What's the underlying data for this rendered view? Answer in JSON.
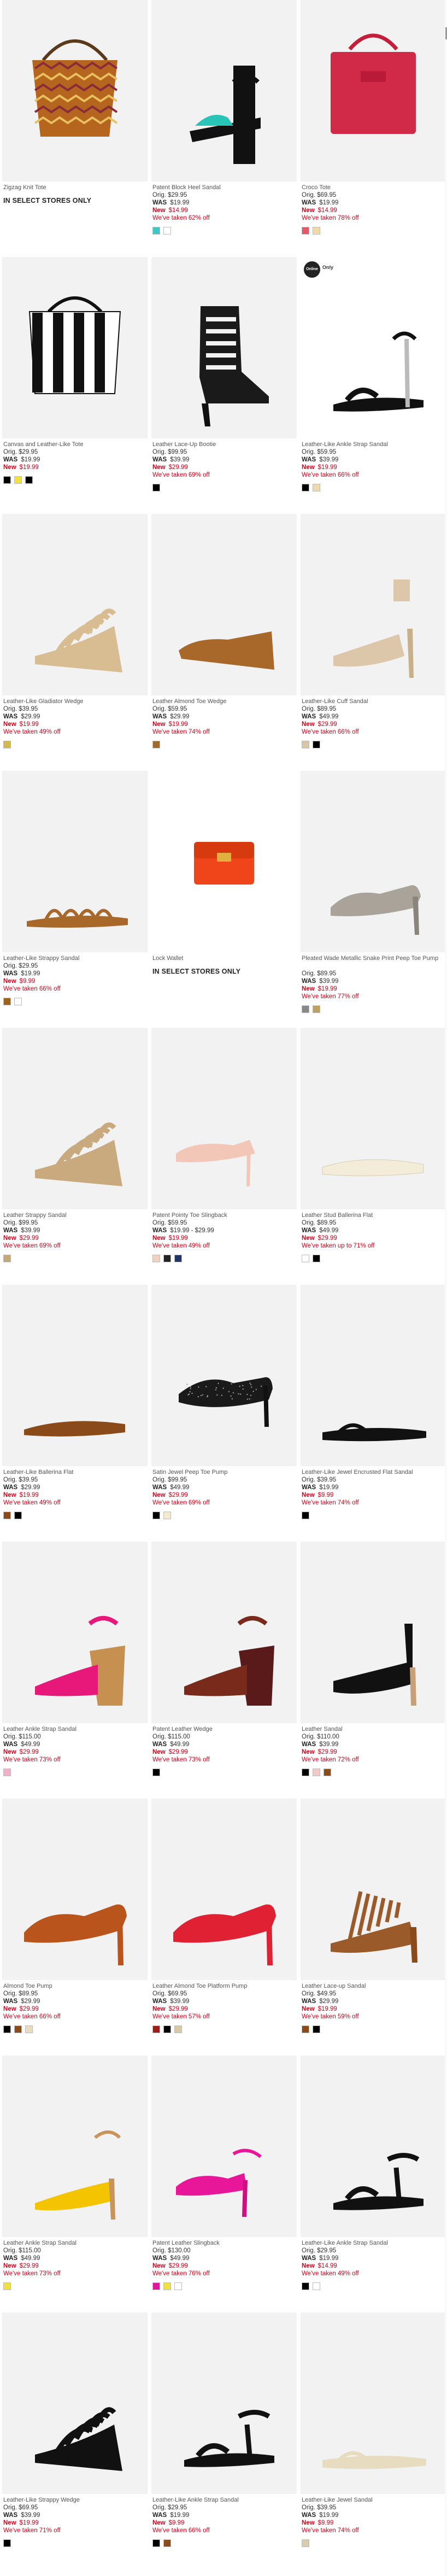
{
  "products": [
    {
      "name": "Zigzag Knit Tote",
      "in_store": "IN SELECT STORES ONLY",
      "shape": "tote-zigzag",
      "swatches": []
    },
    {
      "name": "Patent Block Heel Sandal",
      "orig": "Orig. $29.95",
      "was": "$19.99",
      "new": "$14.99",
      "taken": "We've taken 62% off",
      "shape": "sandal-block",
      "swatches": [
        "#3fc7c7",
        "#ffffff"
      ]
    },
    {
      "name": "Croco Tote",
      "orig": "Orig. $69.95",
      "was": "$19.99",
      "new": "$14.99",
      "taken": "We've taken 78% off",
      "shape": "tote-red",
      "swatches": [
        "#e05a6a",
        "#f2d9a8"
      ]
    },
    {
      "name": "Canvas and Leather-Like Tote",
      "orig": "Orig. $29.95",
      "was": "$19.99",
      "new": "$19.99",
      "shape": "tote-stripe",
      "swatches": [
        "#000000",
        "#f0e040",
        "#000000"
      ]
    },
    {
      "name": "Leather Lace-Up Bootie",
      "orig": "Orig. $99.95",
      "was": "$39.99",
      "new": "$29.99",
      "taken": "We've taken 69% off",
      "shape": "bootie-black",
      "swatches": [
        "#000000"
      ]
    },
    {
      "name": "Leather-Like Ankle Strap Sandal",
      "orig": "Orig. $59.95",
      "was": "$39.99",
      "new": "$19.99",
      "taken": "We've taken 66% off",
      "shape": "sandal-black",
      "badge": "Online",
      "badge_side": "Only",
      "swatches": [
        "#000000",
        "#f0d9b0"
      ]
    },
    {
      "name": "Leather-Like Gladiator Wedge",
      "orig": "Orig. $39.95",
      "was": "$29.99",
      "new": "$19.99",
      "taken": "We've taken 49% off",
      "shape": "wedge-beige",
      "swatches": [
        "#d4b84a"
      ]
    },
    {
      "name": "Leather Almond Toe Wedge",
      "orig": "Orig. $59.95",
      "was": "$29.99",
      "new": "$19.99",
      "taken": "We've taken 74% off",
      "shape": "wedge-tan",
      "swatches": [
        "#a06a2a"
      ]
    },
    {
      "name": "Leather-Like Cuff Sandal",
      "orig": "Orig. $89.95",
      "was": "$49.99",
      "new": "$29.99",
      "taken": "We've taken 66% off",
      "shape": "cuff-nude",
      "swatches": [
        "#d9c6a5",
        "#000000"
      ]
    },
    {
      "name": "Leather-Like Strappy Sandal",
      "orig": "Orig. $29.95",
      "was": "$19.99",
      "new": "$9.99",
      "taken": "We've taken 66% off",
      "shape": "flat-brown",
      "swatches": [
        "#a0621a",
        "#ffffff"
      ]
    },
    {
      "name": "Lock Wallet",
      "in_store": "IN SELECT STORES ONLY",
      "shape": "wallet-red",
      "swatches": []
    },
    {
      "name": "Pleated Wade Metallic Snake Print Peep Toe Pump",
      "orig": "Orig. $89.95",
      "was": "$39.99",
      "new": "$19.99",
      "taken": "We've taken 77% off",
      "shape": "pump-silver",
      "swatches": [
        "#888888",
        "#c0a060"
      ]
    },
    {
      "name": "Leather Strappy Sandal",
      "orig": "Orig. $99.95",
      "was": "$39.99",
      "new": "$29.99",
      "taken": "We've taken 69% off",
      "shape": "strappy-beige",
      "swatches": [
        "#c4a878"
      ]
    },
    {
      "name": "Patent Pointy Toe Slingback",
      "orig": "Orig. $59.95",
      "was": "$19.99 - $29.99",
      "new": "$19.99",
      "taken": "We've taken 49% off",
      "shape": "sling-pink",
      "swatches": [
        "#f3d1c2",
        "#222222",
        "#223366"
      ]
    },
    {
      "name": "Leather Stud Ballerina Flat",
      "orig": "Orig. $89.95",
      "was": "$49.99",
      "new": "$29.99",
      "taken": "We've taken up to 71% off",
      "shape": "flat-white",
      "swatches": [
        "#ffffff",
        "#000000"
      ]
    },
    {
      "name": "Leather-Like Ballerina Flat",
      "orig": "Orig. $39.95",
      "was": "$29.99",
      "new": "$19.99",
      "taken": "We've taken 49% off",
      "shape": "ballet-brown",
      "swatches": [
        "#8a4a1a",
        "#000000"
      ]
    },
    {
      "name": "Satin Jewel Peep Toe Pump",
      "orig": "Orig. $99.95",
      "was": "$49.99",
      "new": "$29.99",
      "taken": "We've taken 69% off",
      "shape": "pump-jewel",
      "swatches": [
        "#000000",
        "#f3ead0"
      ]
    },
    {
      "name": "Leather-Like Jewel Encrusted Flat Sandal",
      "orig": "Orig. $39.95",
      "was": "$19.99",
      "new": "$9.99",
      "taken": "We've taken 74% off",
      "shape": "thong-black",
      "swatches": [
        "#000000"
      ]
    },
    {
      "name": "Leather Ankle Strap Sandal",
      "orig": "Orig. $115.00",
      "was": "$49.99",
      "new": "$29.99",
      "taken": "We've taken 73% off",
      "shape": "wedge-pink",
      "swatches": [
        "#f2b0c8"
      ]
    },
    {
      "name": "Patent Leather Wedge",
      "orig": "Orig. $115.00",
      "was": "$49.99",
      "new": "$29.99",
      "taken": "We've taken 73% off",
      "shape": "wedge-black",
      "swatches": [
        "#000000"
      ]
    },
    {
      "name": "Leather Sandal",
      "orig": "Orig. $110.00",
      "was": "$39.99",
      "new": "$29.99",
      "taken": "We've taken 72% off",
      "shape": "buckle-black",
      "swatches": [
        "#000000",
        "#f2c8c8",
        "#8a4a1a"
      ]
    },
    {
      "name": "Almond Toe Pump",
      "orig": "Orig. $89.95",
      "was": "$29.99",
      "new": "$29.99",
      "taken": "We've taken 66% off",
      "shape": "pump-brown",
      "swatches": [
        "#000000",
        "#8a4a1a",
        "#e8dcc0"
      ]
    },
    {
      "name": "Leather Almond Toe Platform Pump",
      "orig": "Orig. $69.95",
      "was": "$39.99",
      "new": "$29.99",
      "taken": "We've taken 57% off",
      "shape": "pump-red",
      "swatches": [
        "#9b1b1b",
        "#000000",
        "#d8c8a8"
      ]
    },
    {
      "name": "Leather Lace-up Sandal",
      "orig": "Orig. $49.95",
      "was": "$29.99",
      "new": "$19.99",
      "taken": "We've taken 59% off",
      "shape": "lace-brown",
      "swatches": [
        "#8a4a1a",
        "#000000"
      ]
    },
    {
      "name": "Leather Ankle Strap Sandal",
      "orig": "Orig. $115.00",
      "was": "$49.99",
      "new": "$29.99",
      "taken": "We've taken 73% off",
      "shape": "sandal-yellow",
      "swatches": [
        "#f0e040"
      ]
    },
    {
      "name": "Patent Leather Slingback",
      "orig": "Orig. $130.00",
      "was": "$49.99",
      "new": "$29.99",
      "taken": "We've taken 76% off",
      "shape": "sling-pink2",
      "swatches": [
        "#e0179a",
        "#f0e040",
        "#ffffff"
      ]
    },
    {
      "name": "Leather-Like Ankle Strap Sandal",
      "orig": "Orig. $29.95",
      "was": "$19.99",
      "new": "$14.99",
      "taken": "We've taken 49% off",
      "shape": "sandal-flat-black",
      "swatches": [
        "#000000",
        "#ffffff"
      ]
    },
    {
      "name": "Leather-Like Strappy Wedge",
      "orig": "Orig. $69.95",
      "was": "$39.99",
      "new": "$19.99",
      "taken": "We've taken 71% off",
      "shape": "wedge-cage",
      "swatches": [
        "#000000"
      ]
    },
    {
      "name": "Leather-Like Ankle Strap Sandal",
      "orig": "Orig. $29.95",
      "was": "$19.99",
      "new": "$9.99",
      "taken": "We've taken 66% off",
      "shape": "sandal-flat2",
      "swatches": [
        "#000000",
        "#8a4a1a"
      ]
    },
    {
      "name": "Leather-Like Jewel Sandal",
      "orig": "Orig. $39.95",
      "was": "$19.99",
      "new": "$9.99",
      "taken": "We've taken 74% off",
      "shape": "thong-white",
      "swatches": [
        "#d8ccb0"
      ]
    }
  ],
  "labels": {
    "was": "WAS",
    "new": "New"
  }
}
